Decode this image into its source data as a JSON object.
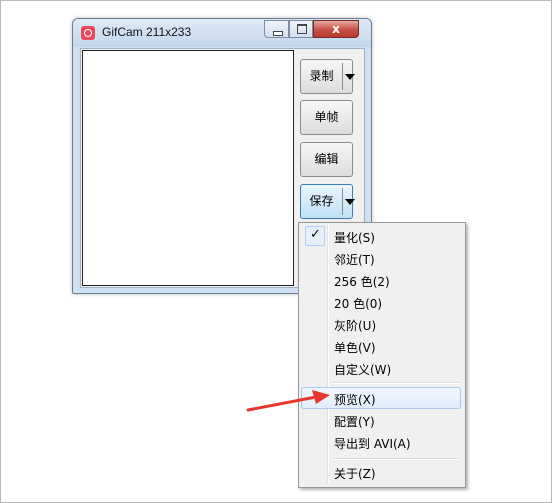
{
  "window": {
    "title": "GifCam 211x233",
    "close_glyph": "x"
  },
  "buttons": {
    "record": "录制",
    "single_frame": "单帧",
    "edit": "编辑",
    "save": "保存"
  },
  "menu": {
    "checkmark": "✓",
    "items": [
      {
        "label": "量化(S)",
        "checked": true
      },
      {
        "label": "邻近(T)"
      },
      {
        "label": "256 色(2)"
      },
      {
        "label": "20 色(0)"
      },
      {
        "label": "灰阶(U)"
      },
      {
        "label": "单色(V)"
      },
      {
        "label": "自定义(W)"
      },
      {
        "label": "预览(X)",
        "highlighted": true
      },
      {
        "label": "配置(Y)"
      },
      {
        "label": "导出到 AVI(A)"
      },
      {
        "label": "关于(Z)"
      }
    ]
  },
  "colors": {
    "annotation_arrow": "#e8372c",
    "close_button": "#c75046"
  }
}
